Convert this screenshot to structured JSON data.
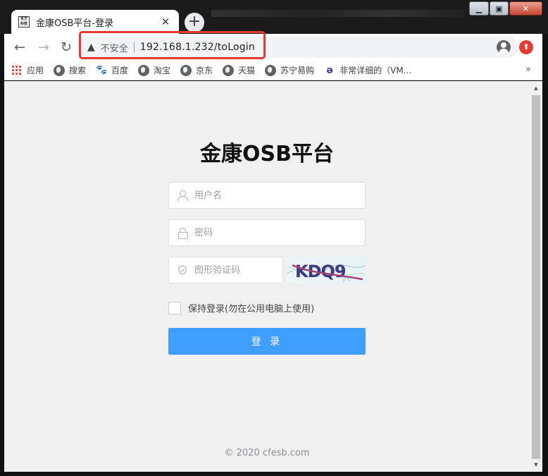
{
  "tab": {
    "favicon_text": "东方科技",
    "title": "金康OSB平台-登录",
    "close_glyph": "✕",
    "new_tab_glyph": "+"
  },
  "window_controls": {
    "minimize": "▁",
    "maximize": "▣",
    "close": "✕"
  },
  "omnibox": {
    "security_label": "不安全",
    "url": "192.168.1.232/toLogin"
  },
  "bookmarks": [
    {
      "label": "应用",
      "icon": "apps-icon"
    },
    {
      "label": "搜索",
      "icon": "globe-icon"
    },
    {
      "label": "百度",
      "icon": "baidu-icon"
    },
    {
      "label": "淘宝",
      "icon": "globe-icon"
    },
    {
      "label": "京东",
      "icon": "globe-icon"
    },
    {
      "label": "天猫",
      "icon": "globe-icon"
    },
    {
      "label": "苏宁易购",
      "icon": "globe-icon"
    },
    {
      "label": "非常详细的（VM...",
      "icon": "v-icon"
    }
  ],
  "bookmarks_more": "»",
  "login": {
    "title": "金康OSB平台",
    "username_placeholder": "用户名",
    "password_placeholder": "密码",
    "captcha_placeholder": "图形验证码",
    "captcha_text": "KDQ9",
    "remember_label": "保持登录(勿在公用电脑上使用)",
    "submit_label": "登 录"
  },
  "footer": {
    "copyright": "© 2020 cfesb.com"
  },
  "colors": {
    "primary": "#409eff",
    "highlight": "#e53935"
  }
}
